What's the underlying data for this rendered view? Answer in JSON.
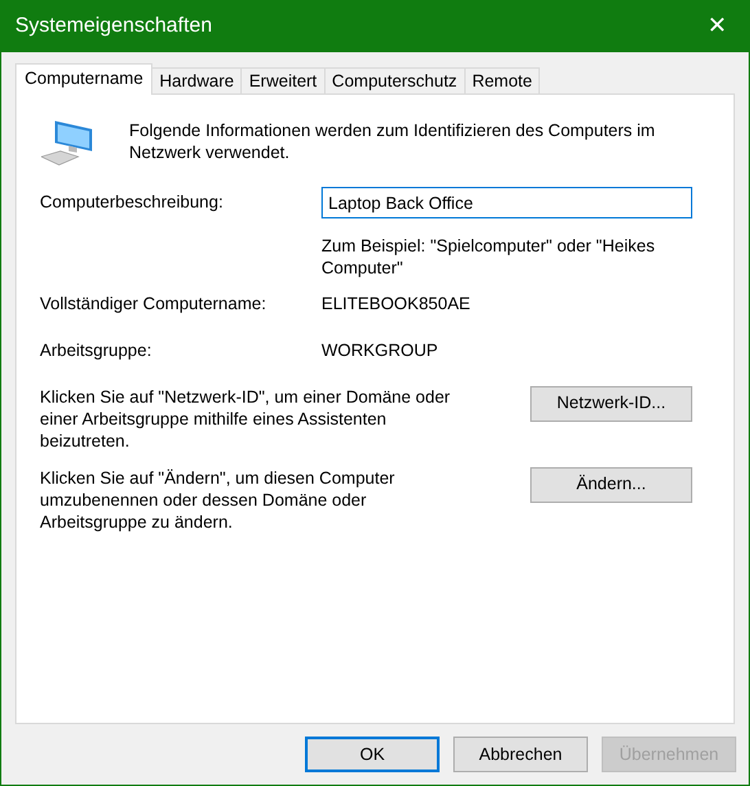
{
  "window": {
    "title": "Systemeigenschaften",
    "close": "✕"
  },
  "tabs": [
    {
      "label": "Computername",
      "selected": true
    },
    {
      "label": "Hardware",
      "selected": false
    },
    {
      "label": "Erweitert",
      "selected": false
    },
    {
      "label": "Computerschutz",
      "selected": false
    },
    {
      "label": "Remote",
      "selected": false
    }
  ],
  "intro": "Folgende Informationen werden zum Identifizieren des Computers im Netzwerk verwendet.",
  "description": {
    "label": "Computerbeschreibung:",
    "value": "Laptop Back Office",
    "hint": "Zum Beispiel: \"Spielcomputer\" oder \"Heikes Computer\""
  },
  "fields": [
    {
      "label": "Vollständiger Computername:",
      "value": "ELITEBOOK850AE"
    },
    {
      "label": "Arbeitsgruppe:",
      "value": "WORKGROUP"
    }
  ],
  "actions": [
    {
      "text": "Klicken Sie auf \"Netzwerk-ID\", um einer Domäne oder einer Arbeitsgruppe mithilfe eines Assistenten beizutreten.",
      "button": "Netzwerk-ID..."
    },
    {
      "text": "Klicken Sie auf \"Ändern\", um diesen Computer umzubenennen oder dessen Domäne oder Arbeitsgruppe zu ändern.",
      "button": "Ändern..."
    }
  ],
  "buttons": [
    {
      "label": "OK",
      "default": true,
      "disabled": false
    },
    {
      "label": "Abbrechen",
      "default": false,
      "disabled": false
    },
    {
      "label": "Übernehmen",
      "default": false,
      "disabled": true
    }
  ]
}
